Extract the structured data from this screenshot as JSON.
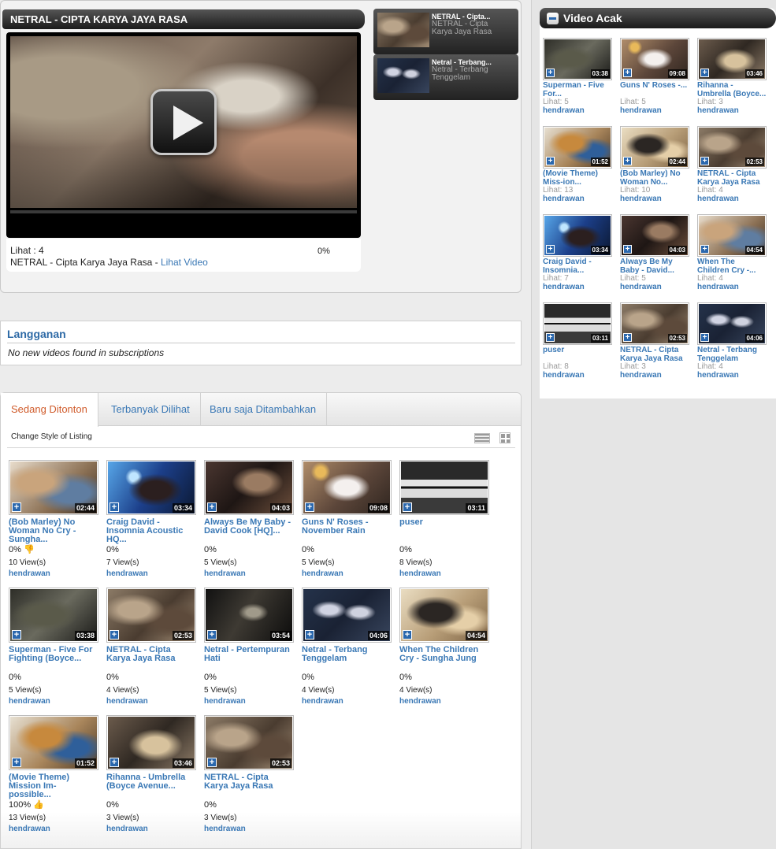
{
  "featured": {
    "title": "NETRAL - CIPTA KARYA JAYA RASA",
    "views": "Lihat : 4",
    "caption": "NETRAL - Cipta Karya Jaya Rasa",
    "separator": " - ",
    "watch_link": "Lihat Video",
    "rating": "0%",
    "side_clips": [
      {
        "title": "NETRAL - Cipta...",
        "subtitle": "NETRAL - Cipta Karya Jaya Rasa"
      },
      {
        "title": "Netral - Terbang...",
        "subtitle": "Netral - Terbang Tenggelam"
      }
    ]
  },
  "subscriptions": {
    "title": "Langganan",
    "empty_message": "No new videos found in subscriptions"
  },
  "listing": {
    "tabs": [
      "Sedang Ditonton",
      "Terbanyak Dilihat",
      "Baru saja Ditambahkan"
    ],
    "change_style_label": "Change Style of Listing",
    "videos": [
      {
        "title": "(Bob Marley) No Woman No Cry - Sungha...",
        "duration": "02:44",
        "rating": "0%",
        "views": "10 View(s)",
        "user": "hendrawan",
        "rate_icon": "thumb-down"
      },
      {
        "title": "Craig David - Insomnia Acoustic HQ...",
        "duration": "03:34",
        "rating": "0%",
        "views": "7 View(s)",
        "user": "hendrawan",
        "rate_icon": ""
      },
      {
        "title": "Always Be My Baby - David Cook [HQ]...",
        "duration": "04:03",
        "rating": "0%",
        "views": "5 View(s)",
        "user": "hendrawan",
        "rate_icon": ""
      },
      {
        "title": "Guns N' Roses - November Rain",
        "duration": "09:08",
        "rating": "0%",
        "views": "5 View(s)",
        "user": "hendrawan",
        "rate_icon": ""
      },
      {
        "title": "puser",
        "duration": "03:11",
        "rating": "0%",
        "views": "8 View(s)",
        "user": "hendrawan",
        "rate_icon": ""
      },
      {
        "title": "Superman - Five For Fighting (Boyce...",
        "duration": "03:38",
        "rating": "0%",
        "views": "5 View(s)",
        "user": "hendrawan",
        "rate_icon": ""
      },
      {
        "title": "NETRAL - Cipta Karya Jaya Rasa",
        "duration": "02:53",
        "rating": "0%",
        "views": "4 View(s)",
        "user": "hendrawan",
        "rate_icon": ""
      },
      {
        "title": "Netral - Pertempuran Hati",
        "duration": "03:54",
        "rating": "0%",
        "views": "5 View(s)",
        "user": "hendrawan",
        "rate_icon": ""
      },
      {
        "title": "Netral - Terbang Tenggelam",
        "duration": "04:06",
        "rating": "0%",
        "views": "4 View(s)",
        "user": "hendrawan",
        "rate_icon": ""
      },
      {
        "title": "When The Children Cry - Sungha Jung",
        "duration": "04:54",
        "rating": "0%",
        "views": "4 View(s)",
        "user": "hendrawan",
        "rate_icon": ""
      },
      {
        "title": "(Movie Theme) Mission Im-possible...",
        "duration": "01:52",
        "rating": "100%",
        "views": "13 View(s)",
        "user": "hendrawan",
        "rate_icon": "thumb-up"
      },
      {
        "title": "Rihanna - Umbrella (Boyce Avenue...",
        "duration": "03:46",
        "rating": "0%",
        "views": "3 View(s)",
        "user": "hendrawan",
        "rate_icon": ""
      },
      {
        "title": "NETRAL - Cipta Karya Jaya Rasa",
        "duration": "02:53",
        "rating": "0%",
        "views": "3 View(s)",
        "user": "hendrawan",
        "rate_icon": ""
      }
    ]
  },
  "random": {
    "title": "Video Acak",
    "videos": [
      {
        "title": "Superman - Five For...",
        "duration": "03:38",
        "views": "Lihat: 5",
        "user": "hendrawan"
      },
      {
        "title": "Guns N' Roses -...",
        "duration": "09:08",
        "views": "Lihat: 5",
        "user": "hendrawan"
      },
      {
        "title": "Rihanna - Umbrella (Boyce...",
        "duration": "03:46",
        "views": "Lihat: 3",
        "user": "hendrawan"
      },
      {
        "title": "(Movie Theme) Miss-ion...",
        "duration": "01:52",
        "views": "Lihat: 13",
        "user": "hendrawan"
      },
      {
        "title": "(Bob Marley) No Woman No...",
        "duration": "02:44",
        "views": "Lihat: 10",
        "user": "hendrawan"
      },
      {
        "title": "NETRAL - Cipta Karya Jaya Rasa",
        "duration": "02:53",
        "views": "Lihat: 4",
        "user": "hendrawan"
      },
      {
        "title": "Craig David - Insomnia...",
        "duration": "03:34",
        "views": "Lihat: 7",
        "user": "hendrawan"
      },
      {
        "title": "Always Be My Baby - David...",
        "duration": "04:03",
        "views": "Lihat: 5",
        "user": "hendrawan"
      },
      {
        "title": "When The Children Cry -...",
        "duration": "04:54",
        "views": "Lihat: 4",
        "user": "hendrawan"
      },
      {
        "title": "puser",
        "duration": "03:11",
        "views": "Lihat: 8",
        "user": "hendrawan"
      },
      {
        "title": "NETRAL - Cipta Karya Jaya Rasa",
        "duration": "02:53",
        "views": "Lihat: 3",
        "user": "hendrawan"
      },
      {
        "title": "Netral - Terbang Tenggelam",
        "duration": "04:06",
        "views": "Lihat: 4",
        "user": "hendrawan"
      }
    ]
  },
  "colors": {
    "link": "#3a78b5",
    "active_tab": "#d05c2c",
    "header_dark": "#1b1b1b",
    "add_button": "#2a67ad"
  },
  "icons": {
    "play": "play-icon",
    "add": "add-to-playlist-icon",
    "collapse": "collapse-icon",
    "list_view": "list-view-icon",
    "grid_view": "grid-view-icon",
    "thumb_down": "thumb-down-icon",
    "thumb_up": "thumb-up-icon"
  }
}
